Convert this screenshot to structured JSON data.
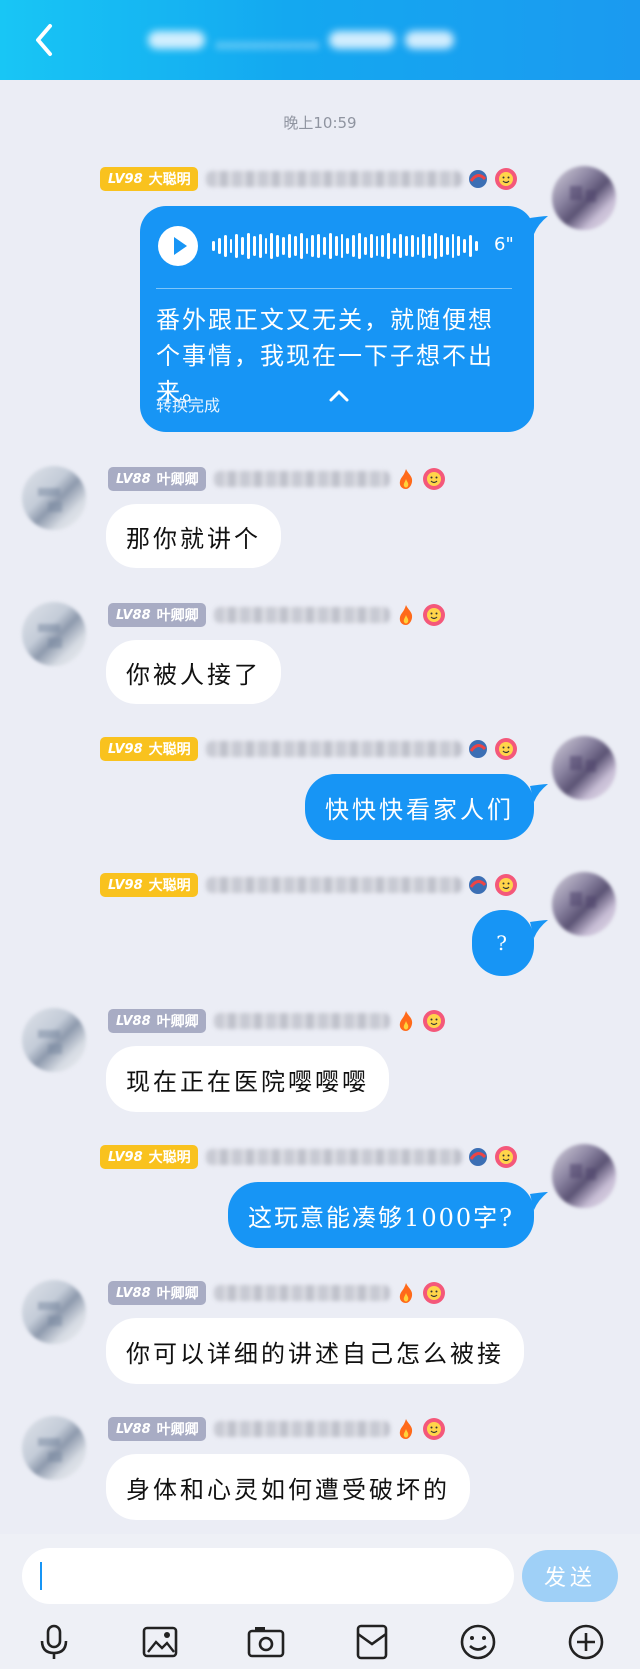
{
  "header": {
    "title": "…………"
  },
  "timestamp": "晚上10:59",
  "self_name": {
    "level": "LV98",
    "name": "大聪明"
  },
  "other_name": {
    "level": "LV88",
    "name": "叶卿卿"
  },
  "voice_message": {
    "duration": "6\"",
    "transcript": "番外跟正文又无关，就随便想个事情，我现在一下子想不出来。",
    "status": "转换完成"
  },
  "messages": [
    {
      "from": "other",
      "text": "那你就讲个"
    },
    {
      "from": "other",
      "text": "你被人接了"
    },
    {
      "from": "self",
      "text": "快快快看家人们"
    },
    {
      "from": "self",
      "text": "?"
    },
    {
      "from": "other",
      "text": "现在正在医院嘤嘤嘤"
    },
    {
      "from": "self",
      "text": "这玩意能凑够1000字?"
    },
    {
      "from": "other",
      "text": "你可以详细的讲述自己怎么被接"
    },
    {
      "from": "other",
      "text": "身体和心灵如何遭受破坏的"
    }
  ],
  "input": {
    "value": "",
    "send_label": "发送"
  },
  "toolbar": [
    "microphone-icon",
    "photo-icon",
    "camera-icon",
    "red-packet-icon",
    "emoji-icon",
    "plus-icon"
  ],
  "colors": {
    "accent": "#1795f5",
    "badge_self": "#f9c21e",
    "badge_other": "#a8acc4"
  }
}
